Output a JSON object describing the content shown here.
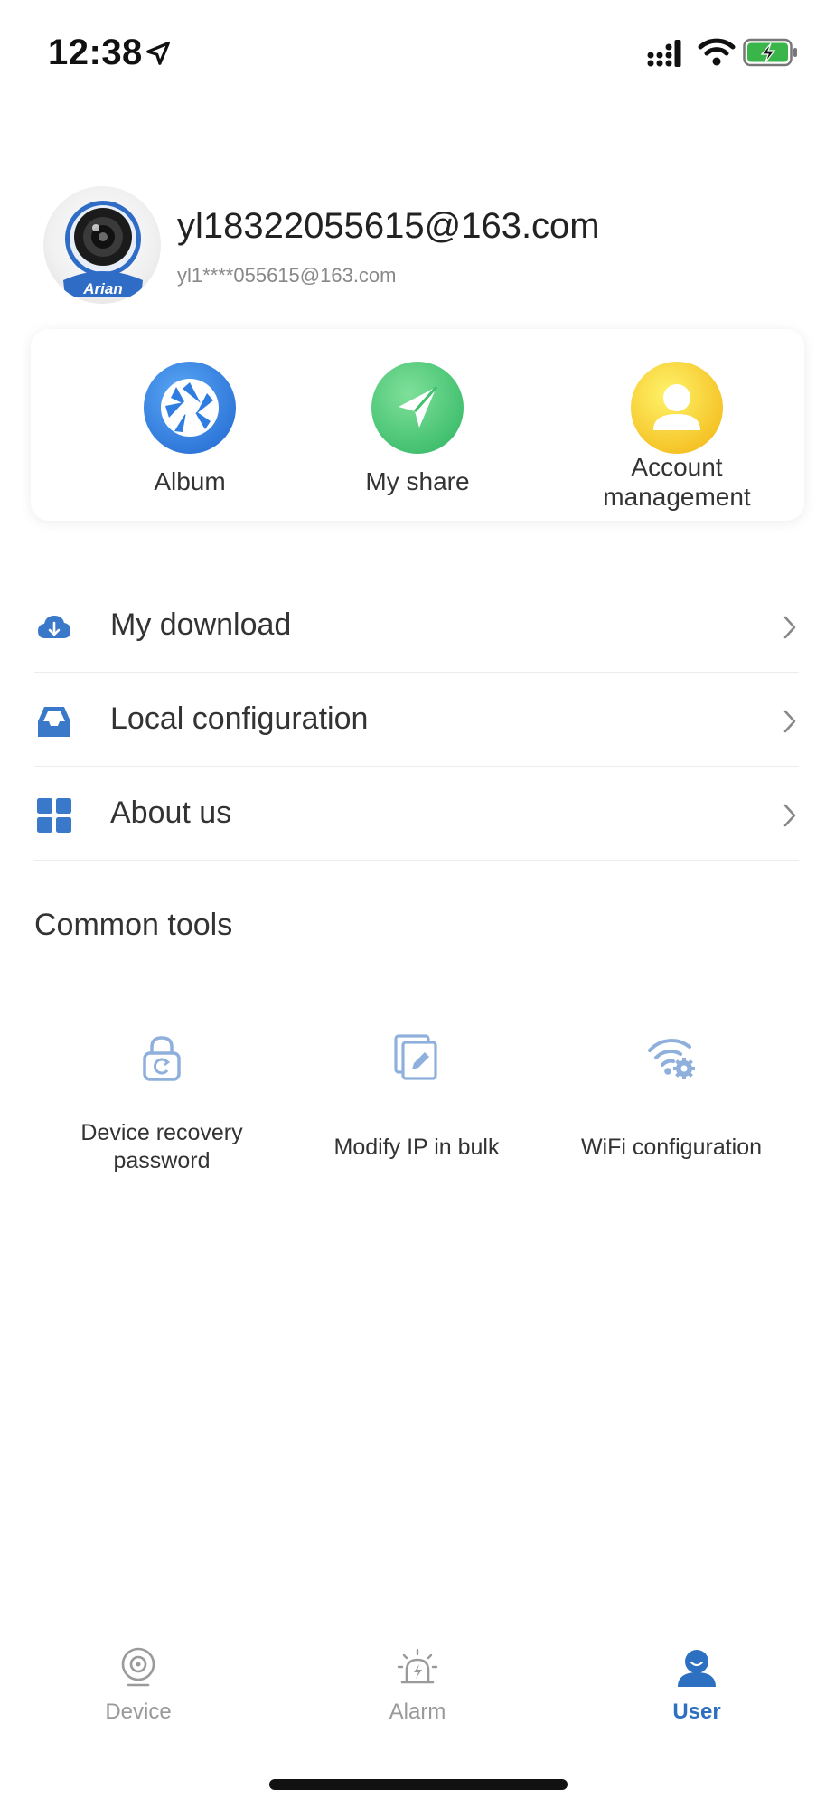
{
  "status_bar": {
    "time": "12:38"
  },
  "profile": {
    "avatar_brand": "Arian",
    "username": "yl18322055615@163.com",
    "masked_email": "yl1****055615@163.com"
  },
  "quick_actions": [
    {
      "label": "Album",
      "icon": "camera-shutter-icon",
      "color": "#2f7de0"
    },
    {
      "label": "My share",
      "icon": "send-icon",
      "color": "#3fc26e"
    },
    {
      "label_line1": "Account",
      "label_line2": "management",
      "icon": "person-icon",
      "color": "#f4c414"
    }
  ],
  "menu": [
    {
      "label": "My download",
      "icon": "cloud-download-icon"
    },
    {
      "label": "Local configuration",
      "icon": "inbox-tray-icon"
    },
    {
      "label": "About us",
      "icon": "grid-icon"
    }
  ],
  "section_title": "Common tools",
  "tools": [
    {
      "label_line1": "Device recovery",
      "label_line2": "password",
      "icon": "lock-reset-icon"
    },
    {
      "label_line1": "Modify IP in bulk",
      "icon": "edit-documents-icon"
    },
    {
      "label_line1": "WiFi configuration",
      "icon": "wifi-settings-icon"
    }
  ],
  "tabbar": {
    "tabs": [
      {
        "label": "Device",
        "icon": "camera-icon",
        "active": false
      },
      {
        "label": "Alarm",
        "icon": "alarm-siren-icon",
        "active": false
      },
      {
        "label": "User",
        "icon": "user-icon",
        "active": true
      }
    ]
  },
  "colors": {
    "accent": "#2d6fc0",
    "tool_icon": "#8fb0dc",
    "muted": "#999999"
  }
}
